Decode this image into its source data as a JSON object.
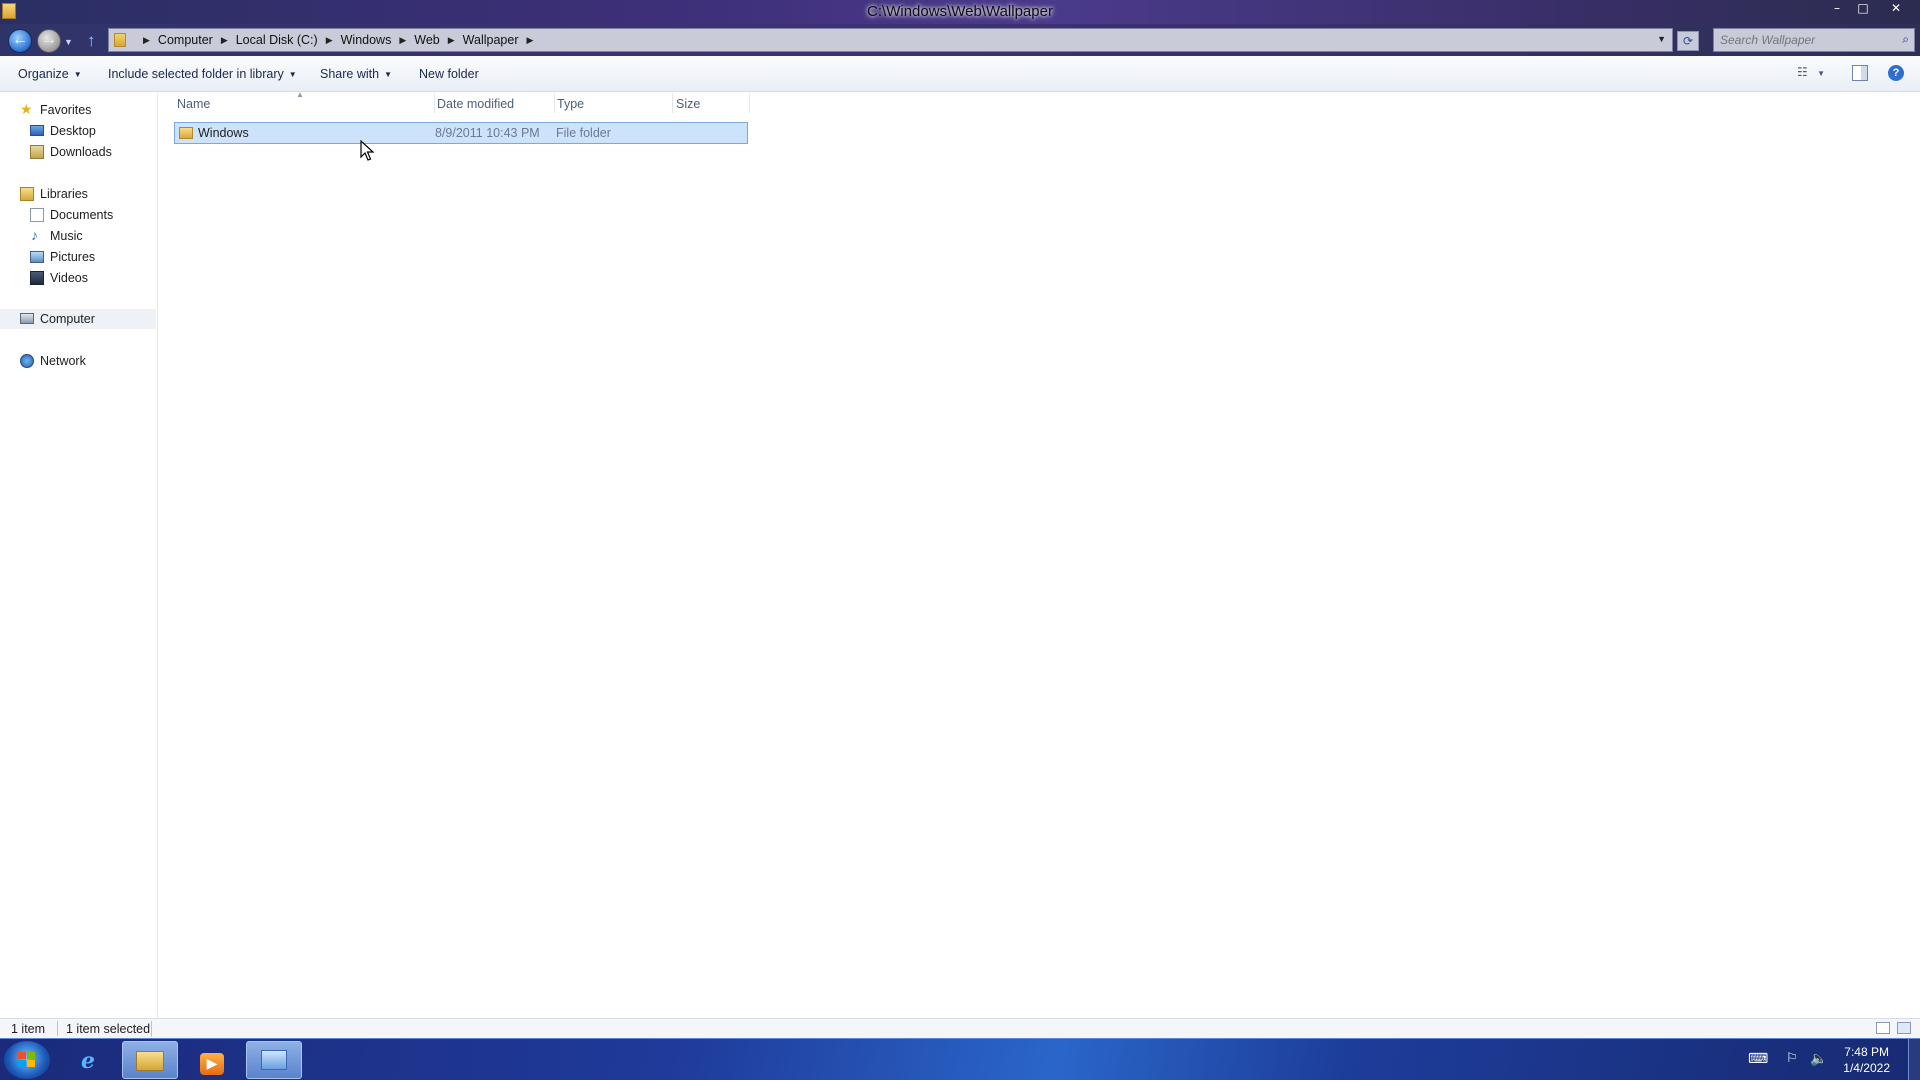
{
  "window": {
    "title": "C:\\Windows\\Web\\Wallpaper",
    "controls": {
      "minimize": "–",
      "maximize": "□",
      "close": "✕"
    }
  },
  "address": {
    "crumbs": [
      "Computer",
      "Local Disk (C:)",
      "Windows",
      "Web",
      "Wallpaper"
    ],
    "search_placeholder": "Search Wallpaper"
  },
  "toolbar": {
    "organize": "Organize",
    "include": "Include selected folder in library",
    "share": "Share with",
    "new_folder": "New folder"
  },
  "nav": {
    "favorites": "Favorites",
    "desktop": "Desktop",
    "downloads": "Downloads",
    "libraries": "Libraries",
    "documents": "Documents",
    "music": "Music",
    "pictures": "Pictures",
    "videos": "Videos",
    "computer": "Computer",
    "network": "Network"
  },
  "columns": {
    "name": "Name",
    "date": "Date modified",
    "type": "Type",
    "size": "Size"
  },
  "files": [
    {
      "name": "Windows",
      "date": "8/9/2011 10:43 PM",
      "type": "File folder",
      "size": ""
    }
  ],
  "status": {
    "count": "1 item",
    "selected": "1 item selected"
  },
  "taskbar": {
    "time": "7:48 PM",
    "date": "1/4/2022"
  },
  "colors": {
    "selection": "#cde3fb",
    "selection_border": "#7ea8dc",
    "header_text": "#4c607a",
    "taskbar": "#1f3a9a"
  }
}
